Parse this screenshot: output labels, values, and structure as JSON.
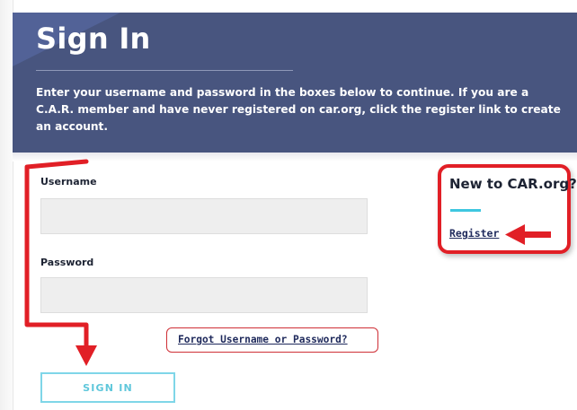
{
  "header": {
    "title": "Sign In",
    "intro": "Enter your username and password in the boxes below to continue. If you are a C.A.R. member and have never registered on car.org, click the register link to create an account."
  },
  "form": {
    "username_label": "Username",
    "username_value": "",
    "password_label": "Password",
    "password_value": "",
    "forgot_link": "Forgot Username or Password?",
    "signin_button": "SIGN IN"
  },
  "register_panel": {
    "title": "New to CAR.org?",
    "register_link": "Register"
  },
  "colors": {
    "banner": "#48557f",
    "annotation_red": "#e11f26",
    "accent_cyan": "#3ec7e0",
    "link_navy": "#1f2a5c"
  },
  "annotations": {
    "form_bracket": "red-bracket-arrow-down",
    "register_arrow": "red-arrow-left"
  }
}
